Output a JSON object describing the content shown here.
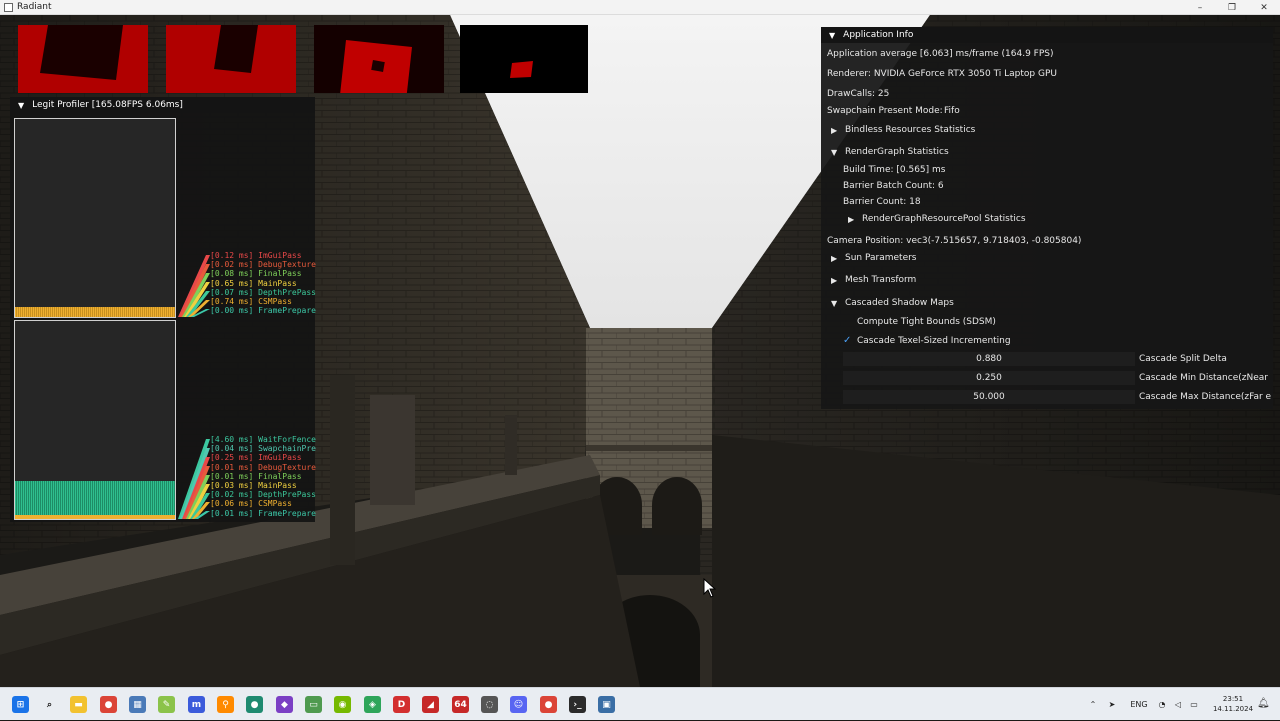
{
  "window": {
    "title": "Radiant",
    "controls": [
      "–",
      "❐",
      "✕"
    ]
  },
  "profiler": {
    "title": "Legit Profiler [165.08FPS   6.06ms]",
    "gpu_legend": [
      {
        "text": "[0.12 ms] ImGuiPass",
        "color": "#e84848"
      },
      {
        "text": "[0.02 ms] DebugTexture",
        "color": "#e85a3c"
      },
      {
        "text": "[0.08 ms] FinalPass",
        "color": "#7fd05a"
      },
      {
        "text": "[0.65 ms] MainPass",
        "color": "#f0d040"
      },
      {
        "text": "[0.07 ms] DepthPrePass",
        "color": "#3cc89a"
      },
      {
        "text": "[0.74 ms] CSMPass",
        "color": "#f0b030"
      },
      {
        "text": "[0.00 ms] FramePrepare",
        "color": "#3cc8a8"
      }
    ],
    "cpu_legend": [
      {
        "text": "[4.60 ms] WaitForFence",
        "color": "#3cc8a0"
      },
      {
        "text": "[0.04 ms] SwapchainPre",
        "color": "#50c8b0"
      },
      {
        "text": "[0.25 ms] ImGuiPass",
        "color": "#e84848"
      },
      {
        "text": "[0.01 ms] DebugTexture",
        "color": "#e85a3c"
      },
      {
        "text": "[0.01 ms] FinalPass",
        "color": "#7fd05a"
      },
      {
        "text": "[0.03 ms] MainPass",
        "color": "#f0d040"
      },
      {
        "text": "[0.02 ms] DepthPrePass",
        "color": "#3cc89a"
      },
      {
        "text": "[0.06 ms] CSMPass",
        "color": "#f0b030"
      },
      {
        "text": "[0.01 ms] FramePrepare",
        "color": "#3cc8a8"
      }
    ]
  },
  "app_info": {
    "title": "Application Info",
    "average": "Application average [6.063] ms/frame (164.9 FPS)",
    "renderer": "Renderer: NVIDIA GeForce RTX 3050 Ti Laptop GPU",
    "drawcalls": "DrawCalls: 25",
    "swapchain_label": "Swapchain Present Mode:",
    "swapchain_value": "Fifo",
    "bindless_node": "Bindless Resources Statistics",
    "rendergraph_node": "RenderGraph Statistics",
    "build_time": "Build Time: [0.565] ms",
    "barrier_batch": "Barrier Batch Count: 6",
    "barrier_count": "Barrier Count: 18",
    "pool_node": "RenderGraphResourcePool Statistics",
    "camera_position": "Camera Position: vec3(-7.515657, 9.718403, -0.805804)",
    "sun_node": "Sun Parameters",
    "mesh_node": "Mesh Transform",
    "csm_node": "Cascaded Shadow Maps",
    "tight_bounds": "Compute Tight Bounds (SDSM)",
    "texel_sized": "Cascade Texel-Sized Incrementing",
    "tight_bounds_checked": false,
    "texel_sized_checked": true,
    "split_delta_value": "0.880",
    "split_delta_label": "Cascade Split Delta",
    "min_dist_value": "0.250",
    "min_dist_label": "Cascade Min Distance(zNear start)",
    "max_dist_value": "50.000",
    "max_dist_label": "Cascade Max Distance(zFar end)"
  },
  "taskbar": {
    "language": "ENG",
    "time": "23:51",
    "date": "14.11.2024",
    "apps": [
      {
        "name": "start",
        "color": "#1a73e8",
        "glyph": "⊞"
      },
      {
        "name": "search",
        "color": "transparent",
        "glyph": "⌕"
      },
      {
        "name": "explorer",
        "color": "#f2c230",
        "glyph": "▬"
      },
      {
        "name": "chrome",
        "color": "#db4437",
        "glyph": "●"
      },
      {
        "name": "photos",
        "color": "#4a7ab8",
        "glyph": "▦"
      },
      {
        "name": "notepad-plus",
        "color": "#8bc34a",
        "glyph": "✎"
      },
      {
        "name": "app-blue",
        "color": "#3b5bdb",
        "glyph": "m"
      },
      {
        "name": "search-app",
        "color": "#ff8a00",
        "glyph": "⚲"
      },
      {
        "name": "app-teal",
        "color": "#1f8a70",
        "glyph": "●"
      },
      {
        "name": "visual-studio",
        "color": "#7b3fc4",
        "glyph": "◆"
      },
      {
        "name": "app-green",
        "color": "#4f9a4f",
        "glyph": "▭"
      },
      {
        "name": "nvidia",
        "color": "#76b900",
        "glyph": "◉"
      },
      {
        "name": "app-green2",
        "color": "#2ea55a",
        "glyph": "◈"
      },
      {
        "name": "app-d",
        "color": "#d32f2f",
        "glyph": "D"
      },
      {
        "name": "app-red",
        "color": "#c62828",
        "glyph": "◢"
      },
      {
        "name": "app-64",
        "color": "#c62828",
        "glyph": "64"
      },
      {
        "name": "app-circle",
        "color": "#555555",
        "glyph": "◌"
      },
      {
        "name": "discord",
        "color": "#5865f2",
        "glyph": "☺"
      },
      {
        "name": "chrome2",
        "color": "#db4437",
        "glyph": "●"
      },
      {
        "name": "terminal",
        "color": "#2b2b2b",
        "glyph": "›_"
      },
      {
        "name": "radiant-app",
        "color": "#3a6ea5",
        "glyph": "▣"
      }
    ]
  }
}
